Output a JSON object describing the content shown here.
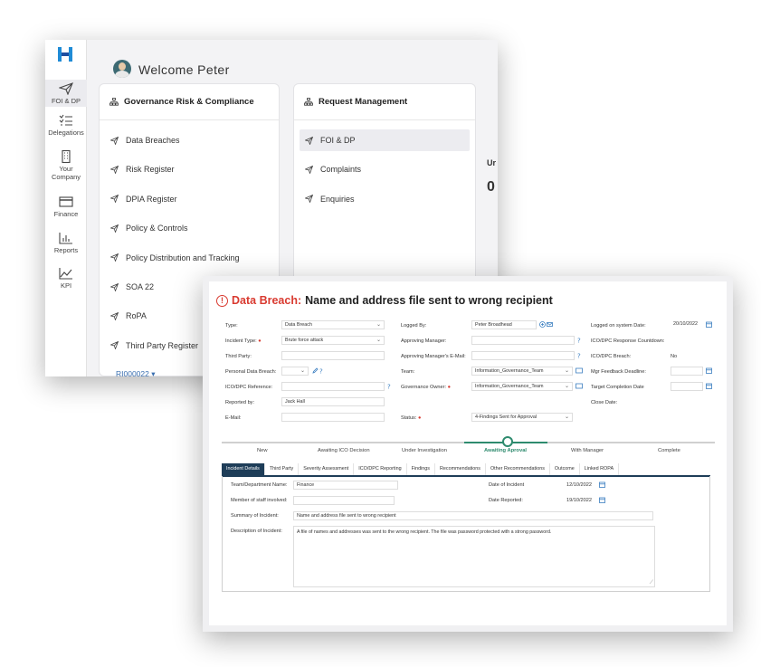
{
  "back_window": {
    "welcome": "Welcome Peter",
    "rail": [
      {
        "label": "FOI & DP",
        "icon": "paper-plane-icon",
        "active": true
      },
      {
        "label": "Delegations",
        "icon": "checklist-icon",
        "active": false
      },
      {
        "label": "Your Company",
        "icon": "building-icon",
        "active": false
      },
      {
        "label": "Finance",
        "icon": "card-icon",
        "active": false
      },
      {
        "label": "Reports",
        "icon": "bar-chart-icon",
        "active": false
      },
      {
        "label": "KPI",
        "icon": "area-chart-icon",
        "active": false
      }
    ],
    "grc": {
      "title": "Governance Risk & Compliance",
      "items": [
        "Data Breaches",
        "Risk Register",
        "DPIA Register",
        "Policy & Controls",
        "Policy Distribution and Tracking",
        "SOA 22",
        "RoPA",
        "Third Party Register"
      ]
    },
    "rm": {
      "title": "Request Management",
      "items": [
        "FOI & DP",
        "Complaints",
        "Enquiries"
      ]
    },
    "peek1": "Ur",
    "peek2": "0",
    "ref": "RI000022"
  },
  "record": {
    "title_prefix": "Data Breach:",
    "title": "Name and address file sent to wrong recipient",
    "labels": {
      "type": "Type:",
      "incident_type": "Incident Type:",
      "third_party": "Third Party:",
      "personal_data_breach": "Personal Data Breach:",
      "ico_ref": "ICO/DPC Reference:",
      "reported_by": "Reported by:",
      "email": "E-Mail:",
      "logged_by": "Logged By:",
      "approving_manager": "Approving Manager:",
      "approving_manager_email": "Approving Manager's E-Mail:",
      "team": "Team:",
      "governance_owner": "Governance Owner:",
      "status": "Status:",
      "logged_on": "Logged on system Date:",
      "countdown": "ICO/DPC Response Countdown:",
      "ico_breach": "ICO/DPC Breach:",
      "mgr_deadline": "Mgr Feedback Deadline:",
      "target_date": "Target Completion Date",
      "close_date": "Close Date:"
    },
    "values": {
      "type": "Data Breach",
      "incident_type": "Brute force attack",
      "reported_by": "Jack Hall",
      "logged_by": "Peter Broadhead",
      "team": "Information_Governance_Team",
      "governance_owner": "Information_Governance_Team",
      "status": "4-Findings Sent for Approval",
      "logged_on": "20/10/2022",
      "ico_breach": "No"
    },
    "steps": [
      "New",
      "Awaiting ICO Decision",
      "Under Investigation",
      "Awaiting Aproval",
      "With Manager",
      "Complete"
    ],
    "active_step": "Awaiting Aproval",
    "tabs": [
      "Incident Details",
      "Third Party",
      "Severity Assessment",
      "ICO/DPC Reporting",
      "Findings",
      "Recommendations",
      "Other Recommendations",
      "Outcome",
      "Linked ROPA"
    ],
    "details": {
      "team_label": "Team/Department Name:",
      "team_value": "Finance",
      "staff_label": "Member of staff involved:",
      "summary_label": "Summary of Incident:",
      "summary_value": "Name and address file sent to wrong recipient",
      "desc_label": "Description of Incident:",
      "desc_value": "A file of names and addresses was sent to the wrong recipient. The file was password protected with a strong password.",
      "date_incident_label": "Date of Incident",
      "date_incident": "12/10/2022",
      "date_reported_label": "Date Reported:",
      "date_reported": "19/10/2022"
    },
    "colors": {
      "accent": "#d93a30",
      "progress": "#2e8b6e",
      "tab_active": "#1e3d58"
    }
  }
}
